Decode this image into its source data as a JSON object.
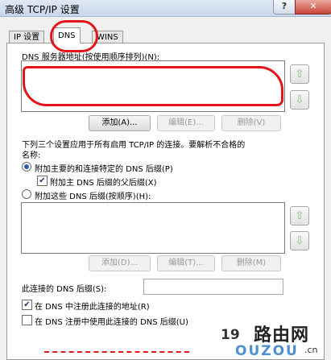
{
  "window": {
    "title": "高级 TCP/IP 设置",
    "help_label": "?",
    "close_label": "✕"
  },
  "tabs": [
    {
      "label": "IP 设置",
      "active": false
    },
    {
      "label": "DNS",
      "active": true
    },
    {
      "label": "WINS",
      "active": false
    }
  ],
  "dns_servers": {
    "label": "DNS 服务器地址(按使用顺序排列)(N):",
    "items": [],
    "add_label": "添加(A)...",
    "edit_label": "编辑(E)...",
    "remove_label": "删除(V)"
  },
  "suffix_section": {
    "info_text_line1": "下列三个设置应用于所有启用 TCP/IP 的连接。要解析不合格的",
    "info_text_line2": "名称:",
    "radio_primary_label": "附加主要的和连接特定的 DNS 后缀(P)",
    "check_parent_label": "附加主 DNS 后缀的父后缀(X)",
    "radio_these_label": "附加这些 DNS 后缀(按顺序)(H):",
    "add_label": "添加(D)...",
    "edit_label": "编辑(T)...",
    "remove_label": "删除(M)"
  },
  "connection_suffix": {
    "label": "此连接的 DNS 后缀(S):",
    "value": ""
  },
  "registration": {
    "register_label": "在 DNS 中注册此连接的地址(R)",
    "register_checked": true,
    "use_suffix_label": "在 DNS 注册中使用此连接的 DNS 后缀(U)",
    "use_suffix_checked": false
  },
  "watermark": {
    "number": "19",
    "brand_cn": "路由网",
    "brand_en": "OUZOU",
    "domain_cn": ".cn"
  },
  "colors": {
    "annotation_red": "#e4141b",
    "arrow_green": "#3a9a3a"
  }
}
